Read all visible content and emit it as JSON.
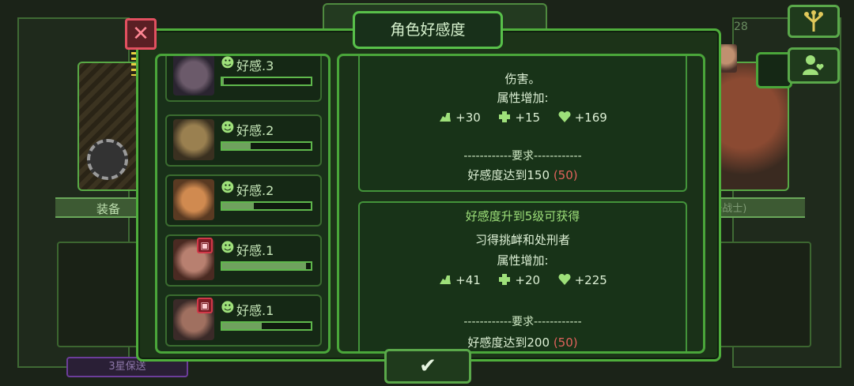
{
  "modal": {
    "title": "角色好感度",
    "confirm_symbol": "✔"
  },
  "characters": [
    {
      "affinity_label": "好感.3",
      "progress": 0.02,
      "locked": false
    },
    {
      "affinity_label": "好感.2",
      "progress": 0.32,
      "locked": false
    },
    {
      "affinity_label": "好感.2",
      "progress": 0.36,
      "locked": false
    },
    {
      "affinity_label": "好感.1",
      "progress": 0.95,
      "locked": true
    },
    {
      "affinity_label": "好感.1",
      "progress": 0.45,
      "locked": true
    }
  ],
  "detail": {
    "section1": {
      "partial_text": "伤害。",
      "attr_heading": "属性增加:",
      "stat_attack": "+30",
      "stat_defense": "+15",
      "stat_health": "+169",
      "requirement_heading": "------------要求------------",
      "requirement_text": "好感度达到150",
      "requirement_current": "(50)"
    },
    "section2": {
      "heading": "好感度升到5级可获得",
      "skill_prefix": "习得",
      "skill_name": "挑衅和处刑者",
      "attr_heading": "属性增加:",
      "stat_attack": "+41",
      "stat_defense": "+20",
      "stat_health": "+225",
      "requirement_heading": "------------要求------------",
      "requirement_text": "好感度达到200",
      "requirement_current": "(50)"
    }
  },
  "background": {
    "left_ribbon": "装备",
    "right_ribbon": "好感  (先锋战士)",
    "counter": "28",
    "bottom_tag": "3星保送"
  },
  "colors": {
    "accent_green": "#4fae3c",
    "close_red": "#e25060",
    "requirement_red": "#e0625c",
    "stat_green": "#9ee07a"
  },
  "icons": {
    "close": "close-icon",
    "smile": "smile-icon",
    "lock": "lock-icon",
    "attack": "strength-icon",
    "defense": "defense-icon",
    "health": "heart-icon",
    "confirm": "checkmark-icon",
    "skill_tree": "skill-tree-icon",
    "affinity": "person-heart-icon"
  }
}
